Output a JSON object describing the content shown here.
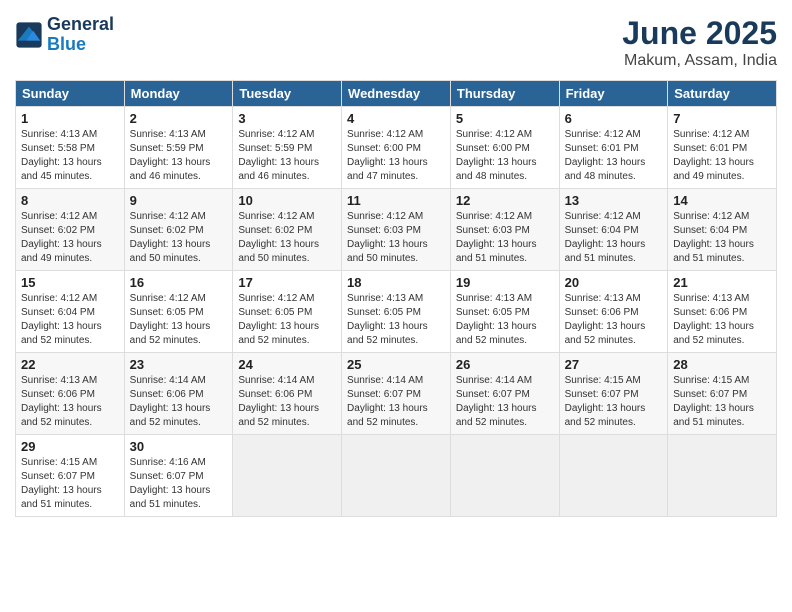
{
  "header": {
    "logo_line1": "General",
    "logo_line2": "Blue",
    "month": "June 2025",
    "location": "Makum, Assam, India"
  },
  "weekdays": [
    "Sunday",
    "Monday",
    "Tuesday",
    "Wednesday",
    "Thursday",
    "Friday",
    "Saturday"
  ],
  "weeks": [
    [
      {
        "day": "1",
        "info": "Sunrise: 4:13 AM\nSunset: 5:58 PM\nDaylight: 13 hours\nand 45 minutes."
      },
      {
        "day": "2",
        "info": "Sunrise: 4:13 AM\nSunset: 5:59 PM\nDaylight: 13 hours\nand 46 minutes."
      },
      {
        "day": "3",
        "info": "Sunrise: 4:12 AM\nSunset: 5:59 PM\nDaylight: 13 hours\nand 46 minutes."
      },
      {
        "day": "4",
        "info": "Sunrise: 4:12 AM\nSunset: 6:00 PM\nDaylight: 13 hours\nand 47 minutes."
      },
      {
        "day": "5",
        "info": "Sunrise: 4:12 AM\nSunset: 6:00 PM\nDaylight: 13 hours\nand 48 minutes."
      },
      {
        "day": "6",
        "info": "Sunrise: 4:12 AM\nSunset: 6:01 PM\nDaylight: 13 hours\nand 48 minutes."
      },
      {
        "day": "7",
        "info": "Sunrise: 4:12 AM\nSunset: 6:01 PM\nDaylight: 13 hours\nand 49 minutes."
      }
    ],
    [
      {
        "day": "8",
        "info": "Sunrise: 4:12 AM\nSunset: 6:02 PM\nDaylight: 13 hours\nand 49 minutes."
      },
      {
        "day": "9",
        "info": "Sunrise: 4:12 AM\nSunset: 6:02 PM\nDaylight: 13 hours\nand 50 minutes."
      },
      {
        "day": "10",
        "info": "Sunrise: 4:12 AM\nSunset: 6:02 PM\nDaylight: 13 hours\nand 50 minutes."
      },
      {
        "day": "11",
        "info": "Sunrise: 4:12 AM\nSunset: 6:03 PM\nDaylight: 13 hours\nand 50 minutes."
      },
      {
        "day": "12",
        "info": "Sunrise: 4:12 AM\nSunset: 6:03 PM\nDaylight: 13 hours\nand 51 minutes."
      },
      {
        "day": "13",
        "info": "Sunrise: 4:12 AM\nSunset: 6:04 PM\nDaylight: 13 hours\nand 51 minutes."
      },
      {
        "day": "14",
        "info": "Sunrise: 4:12 AM\nSunset: 6:04 PM\nDaylight: 13 hours\nand 51 minutes."
      }
    ],
    [
      {
        "day": "15",
        "info": "Sunrise: 4:12 AM\nSunset: 6:04 PM\nDaylight: 13 hours\nand 52 minutes."
      },
      {
        "day": "16",
        "info": "Sunrise: 4:12 AM\nSunset: 6:05 PM\nDaylight: 13 hours\nand 52 minutes."
      },
      {
        "day": "17",
        "info": "Sunrise: 4:12 AM\nSunset: 6:05 PM\nDaylight: 13 hours\nand 52 minutes."
      },
      {
        "day": "18",
        "info": "Sunrise: 4:13 AM\nSunset: 6:05 PM\nDaylight: 13 hours\nand 52 minutes."
      },
      {
        "day": "19",
        "info": "Sunrise: 4:13 AM\nSunset: 6:05 PM\nDaylight: 13 hours\nand 52 minutes."
      },
      {
        "day": "20",
        "info": "Sunrise: 4:13 AM\nSunset: 6:06 PM\nDaylight: 13 hours\nand 52 minutes."
      },
      {
        "day": "21",
        "info": "Sunrise: 4:13 AM\nSunset: 6:06 PM\nDaylight: 13 hours\nand 52 minutes."
      }
    ],
    [
      {
        "day": "22",
        "info": "Sunrise: 4:13 AM\nSunset: 6:06 PM\nDaylight: 13 hours\nand 52 minutes."
      },
      {
        "day": "23",
        "info": "Sunrise: 4:14 AM\nSunset: 6:06 PM\nDaylight: 13 hours\nand 52 minutes."
      },
      {
        "day": "24",
        "info": "Sunrise: 4:14 AM\nSunset: 6:06 PM\nDaylight: 13 hours\nand 52 minutes."
      },
      {
        "day": "25",
        "info": "Sunrise: 4:14 AM\nSunset: 6:07 PM\nDaylight: 13 hours\nand 52 minutes."
      },
      {
        "day": "26",
        "info": "Sunrise: 4:14 AM\nSunset: 6:07 PM\nDaylight: 13 hours\nand 52 minutes."
      },
      {
        "day": "27",
        "info": "Sunrise: 4:15 AM\nSunset: 6:07 PM\nDaylight: 13 hours\nand 52 minutes."
      },
      {
        "day": "28",
        "info": "Sunrise: 4:15 AM\nSunset: 6:07 PM\nDaylight: 13 hours\nand 51 minutes."
      }
    ],
    [
      {
        "day": "29",
        "info": "Sunrise: 4:15 AM\nSunset: 6:07 PM\nDaylight: 13 hours\nand 51 minutes."
      },
      {
        "day": "30",
        "info": "Sunrise: 4:16 AM\nSunset: 6:07 PM\nDaylight: 13 hours\nand 51 minutes."
      },
      {
        "day": "",
        "info": ""
      },
      {
        "day": "",
        "info": ""
      },
      {
        "day": "",
        "info": ""
      },
      {
        "day": "",
        "info": ""
      },
      {
        "day": "",
        "info": ""
      }
    ]
  ]
}
